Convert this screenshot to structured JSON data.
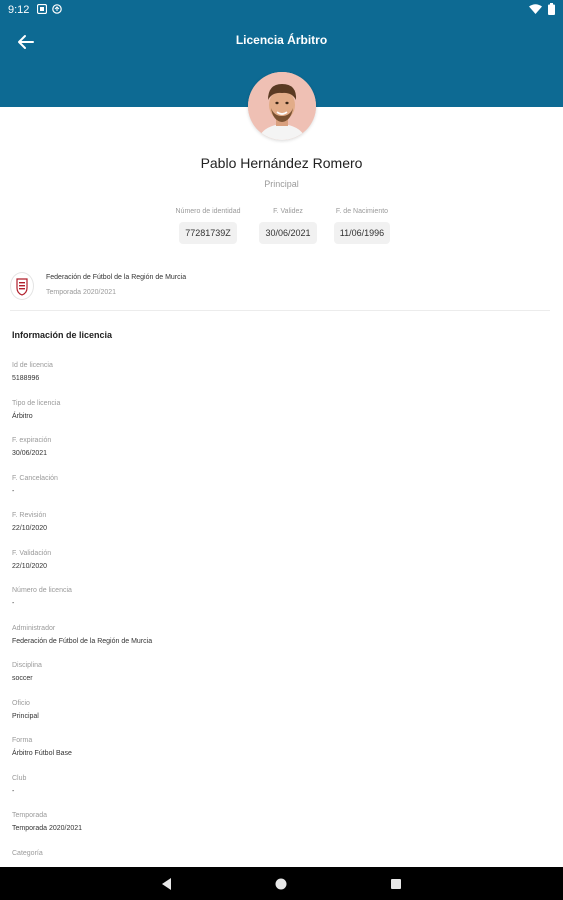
{
  "status_bar": {
    "time": "9:12"
  },
  "app_bar": {
    "title": "Licencia Árbitro"
  },
  "profile": {
    "name": "Pablo Hernández Romero",
    "role": "Principal"
  },
  "id_info": [
    {
      "label": "Número de identidad",
      "value": "77281739Z"
    },
    {
      "label": "F. Validez",
      "value": "30/06/2021"
    },
    {
      "label": "F. de Nacimiento",
      "value": "11/06/1996"
    }
  ],
  "federation": {
    "name": "Federación de Fútbol de la Región de Murcia",
    "season": "Temporada 2020/2021"
  },
  "license_section": {
    "title": "Información de licencia",
    "fields": [
      {
        "label": "Id de licencia",
        "value": "5188996"
      },
      {
        "label": "Tipo de licencia",
        "value": "Árbitro"
      },
      {
        "label": "F. expiración",
        "value": "30/06/2021"
      },
      {
        "label": "F. Cancelación",
        "value": "-"
      },
      {
        "label": "F. Revisión",
        "value": "22/10/2020"
      },
      {
        "label": "F. Validación",
        "value": "22/10/2020"
      },
      {
        "label": "Número de licencia",
        "value": "-"
      },
      {
        "label": "Administrador",
        "value": "Federación de Fútbol de la Región de Murcia"
      },
      {
        "label": "Disciplina",
        "value": "soccer"
      },
      {
        "label": "Oficio",
        "value": "Principal"
      },
      {
        "label": "Forma",
        "value": "Árbitro Fútbol Base"
      },
      {
        "label": "Club",
        "value": "-"
      },
      {
        "label": "Temporada",
        "value": "Temporada 2020/2021"
      },
      {
        "label": "Categoría",
        "value": ""
      }
    ]
  },
  "colors": {
    "header_bg": "#0d6a93",
    "nav_bar_bg": "#000000",
    "chip_bg": "#f1f1f1"
  },
  "icons": {
    "back": "arrow-left-icon",
    "nav_back": "triangle-back-icon",
    "nav_home": "circle-home-icon",
    "nav_recent": "square-recent-icon"
  }
}
